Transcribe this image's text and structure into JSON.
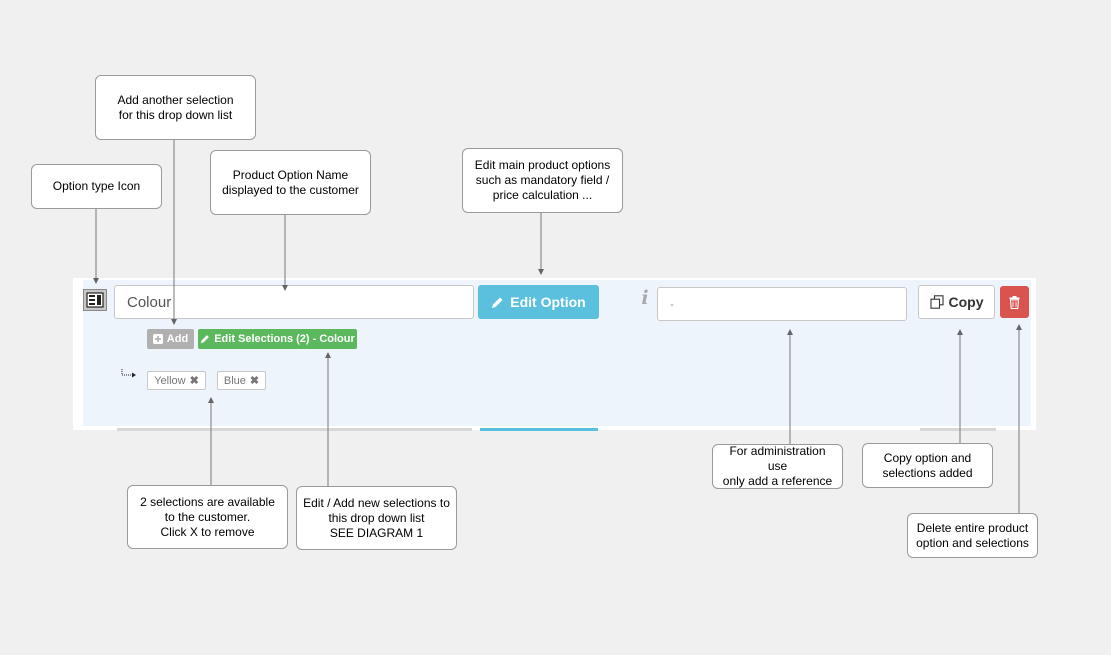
{
  "callouts": {
    "add_selection": "Add another selection\nfor this drop down list",
    "option_type_icon": "Option type Icon",
    "product_option_name": "Product Option Name\ndisplayed to the customer",
    "edit_main_options": "Edit main product options\nsuch as mandatory field /\nprice calculation ...",
    "selections_available": "2 selections are available\nto the customer.\nClick X to remove",
    "edit_add_selections": "Edit / Add new selections to\nthis drop down list\nSEE DIAGRAM 1",
    "admin_reference": "For administration use\nonly add a reference",
    "copy_option": "Copy option and\nselections added",
    "delete_option": "Delete entire product\noption and selections"
  },
  "option_row": {
    "name_value": "Colour",
    "edit_option_label": "Edit Option",
    "info_icon": "info-icon",
    "reference_placeholder": "-",
    "copy_label": "Copy",
    "add_label": "Add",
    "edit_selections_label": "Edit Selections (2) - Colour",
    "selections": [
      {
        "label": "Yellow"
      },
      {
        "label": "Blue"
      }
    ]
  },
  "colors": {
    "info_blue": "#5bc0de",
    "success_green": "#5cb85c",
    "danger_red": "#d9534f",
    "panel_bg": "#eef4fc"
  }
}
